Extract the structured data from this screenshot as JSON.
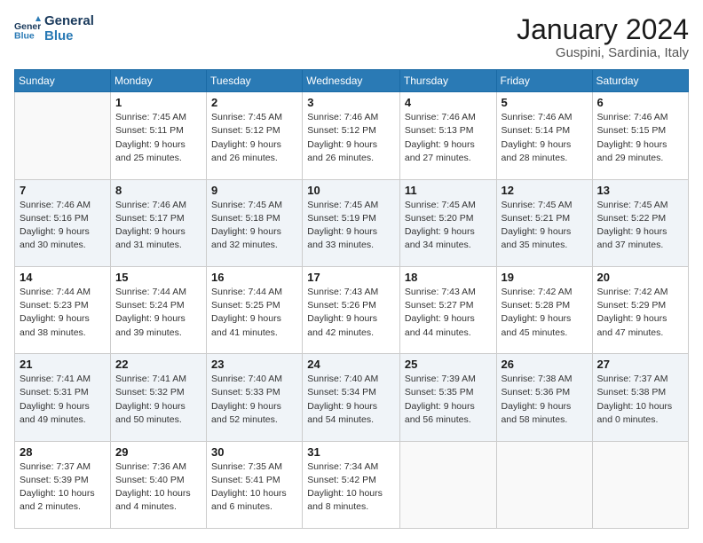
{
  "header": {
    "logo": {
      "line1": "General",
      "line2": "Blue"
    },
    "title": "January 2024",
    "location": "Guspini, Sardinia, Italy"
  },
  "weekdays": [
    "Sunday",
    "Monday",
    "Tuesday",
    "Wednesday",
    "Thursday",
    "Friday",
    "Saturday"
  ],
  "weeks": [
    [
      {
        "date": "",
        "empty": true
      },
      {
        "date": "1",
        "sunrise": "7:45 AM",
        "sunset": "5:11 PM",
        "daylight": "9 hours and 25 minutes."
      },
      {
        "date": "2",
        "sunrise": "7:45 AM",
        "sunset": "5:12 PM",
        "daylight": "9 hours and 26 minutes."
      },
      {
        "date": "3",
        "sunrise": "7:46 AM",
        "sunset": "5:12 PM",
        "daylight": "9 hours and 26 minutes."
      },
      {
        "date": "4",
        "sunrise": "7:46 AM",
        "sunset": "5:13 PM",
        "daylight": "9 hours and 27 minutes."
      },
      {
        "date": "5",
        "sunrise": "7:46 AM",
        "sunset": "5:14 PM",
        "daylight": "9 hours and 28 minutes."
      },
      {
        "date": "6",
        "sunrise": "7:46 AM",
        "sunset": "5:15 PM",
        "daylight": "9 hours and 29 minutes."
      }
    ],
    [
      {
        "date": "7",
        "sunrise": "7:46 AM",
        "sunset": "5:16 PM",
        "daylight": "9 hours and 30 minutes."
      },
      {
        "date": "8",
        "sunrise": "7:46 AM",
        "sunset": "5:17 PM",
        "daylight": "9 hours and 31 minutes."
      },
      {
        "date": "9",
        "sunrise": "7:45 AM",
        "sunset": "5:18 PM",
        "daylight": "9 hours and 32 minutes."
      },
      {
        "date": "10",
        "sunrise": "7:45 AM",
        "sunset": "5:19 PM",
        "daylight": "9 hours and 33 minutes."
      },
      {
        "date": "11",
        "sunrise": "7:45 AM",
        "sunset": "5:20 PM",
        "daylight": "9 hours and 34 minutes."
      },
      {
        "date": "12",
        "sunrise": "7:45 AM",
        "sunset": "5:21 PM",
        "daylight": "9 hours and 35 minutes."
      },
      {
        "date": "13",
        "sunrise": "7:45 AM",
        "sunset": "5:22 PM",
        "daylight": "9 hours and 37 minutes."
      }
    ],
    [
      {
        "date": "14",
        "sunrise": "7:44 AM",
        "sunset": "5:23 PM",
        "daylight": "9 hours and 38 minutes."
      },
      {
        "date": "15",
        "sunrise": "7:44 AM",
        "sunset": "5:24 PM",
        "daylight": "9 hours and 39 minutes."
      },
      {
        "date": "16",
        "sunrise": "7:44 AM",
        "sunset": "5:25 PM",
        "daylight": "9 hours and 41 minutes."
      },
      {
        "date": "17",
        "sunrise": "7:43 AM",
        "sunset": "5:26 PM",
        "daylight": "9 hours and 42 minutes."
      },
      {
        "date": "18",
        "sunrise": "7:43 AM",
        "sunset": "5:27 PM",
        "daylight": "9 hours and 44 minutes."
      },
      {
        "date": "19",
        "sunrise": "7:42 AM",
        "sunset": "5:28 PM",
        "daylight": "9 hours and 45 minutes."
      },
      {
        "date": "20",
        "sunrise": "7:42 AM",
        "sunset": "5:29 PM",
        "daylight": "9 hours and 47 minutes."
      }
    ],
    [
      {
        "date": "21",
        "sunrise": "7:41 AM",
        "sunset": "5:31 PM",
        "daylight": "9 hours and 49 minutes."
      },
      {
        "date": "22",
        "sunrise": "7:41 AM",
        "sunset": "5:32 PM",
        "daylight": "9 hours and 50 minutes."
      },
      {
        "date": "23",
        "sunrise": "7:40 AM",
        "sunset": "5:33 PM",
        "daylight": "9 hours and 52 minutes."
      },
      {
        "date": "24",
        "sunrise": "7:40 AM",
        "sunset": "5:34 PM",
        "daylight": "9 hours and 54 minutes."
      },
      {
        "date": "25",
        "sunrise": "7:39 AM",
        "sunset": "5:35 PM",
        "daylight": "9 hours and 56 minutes."
      },
      {
        "date": "26",
        "sunrise": "7:38 AM",
        "sunset": "5:36 PM",
        "daylight": "9 hours and 58 minutes."
      },
      {
        "date": "27",
        "sunrise": "7:37 AM",
        "sunset": "5:38 PM",
        "daylight": "10 hours and 0 minutes."
      }
    ],
    [
      {
        "date": "28",
        "sunrise": "7:37 AM",
        "sunset": "5:39 PM",
        "daylight": "10 hours and 2 minutes."
      },
      {
        "date": "29",
        "sunrise": "7:36 AM",
        "sunset": "5:40 PM",
        "daylight": "10 hours and 4 minutes."
      },
      {
        "date": "30",
        "sunrise": "7:35 AM",
        "sunset": "5:41 PM",
        "daylight": "10 hours and 6 minutes."
      },
      {
        "date": "31",
        "sunrise": "7:34 AM",
        "sunset": "5:42 PM",
        "daylight": "10 hours and 8 minutes."
      },
      {
        "date": "",
        "empty": true
      },
      {
        "date": "",
        "empty": true
      },
      {
        "date": "",
        "empty": true
      }
    ]
  ]
}
